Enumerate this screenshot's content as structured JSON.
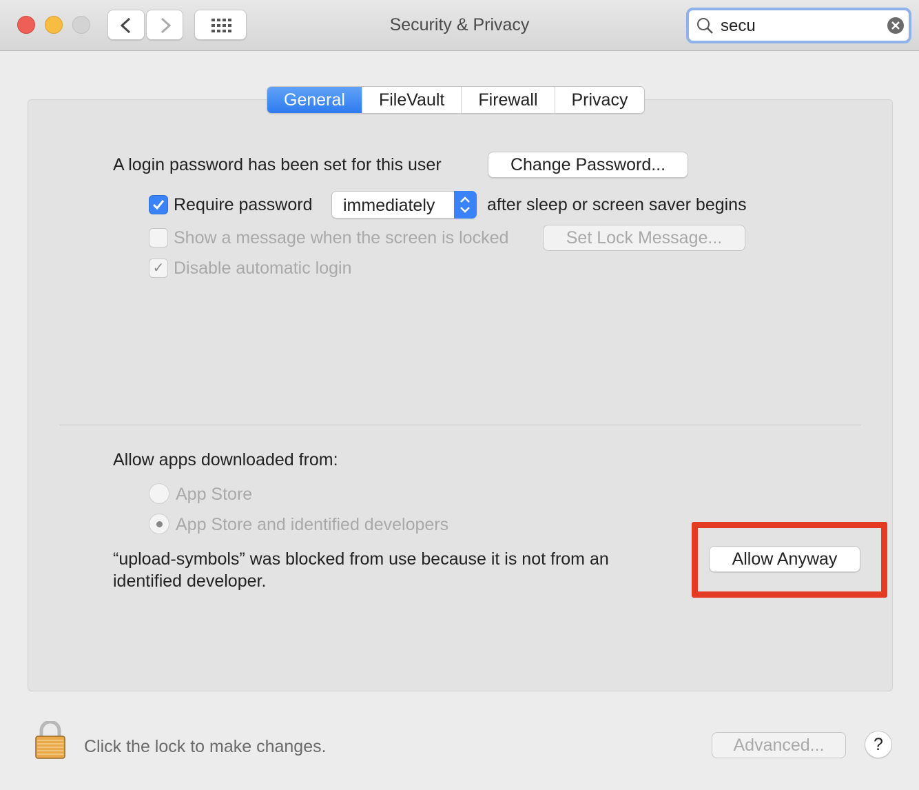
{
  "window": {
    "title": "Security & Privacy"
  },
  "toolbar": {
    "back_icon": "chevron-left",
    "forward_icon": "chevron-right",
    "grid_icon": "grid-icon"
  },
  "search": {
    "value": "secu",
    "icon": "magnifier",
    "clear_icon": "x-circle"
  },
  "tabs": [
    {
      "label": "General",
      "active": true
    },
    {
      "label": "FileVault"
    },
    {
      "label": "Firewall"
    },
    {
      "label": "Privacy"
    }
  ],
  "general": {
    "login_text": "A login password has been set for this user",
    "change_password": "Change Password...",
    "require_password": {
      "label": "Require password",
      "checked": true,
      "select_value": "immediately",
      "suffix": "after sleep or screen saver begins"
    },
    "show_message": {
      "label": "Show a message when the screen is locked",
      "checked": false,
      "button": "Set Lock Message..."
    },
    "disable_autologin": {
      "label": "Disable automatic login",
      "checked": true,
      "check_glyph": "✓"
    },
    "allow_apps_label": "Allow apps downloaded from:",
    "radios": [
      {
        "label": "App Store",
        "selected": false
      },
      {
        "label": "App Store and identified developers",
        "selected": true
      }
    ],
    "blocked_text_1": "“upload-symbols” was blocked from use because it is not from an",
    "blocked_text_2": "identified developer.",
    "allow_anyway": "Allow Anyway",
    "highlight_color": "#e33b24"
  },
  "footer": {
    "lock_text": "Click the lock to make changes.",
    "advanced": "Advanced...",
    "help": "?"
  }
}
